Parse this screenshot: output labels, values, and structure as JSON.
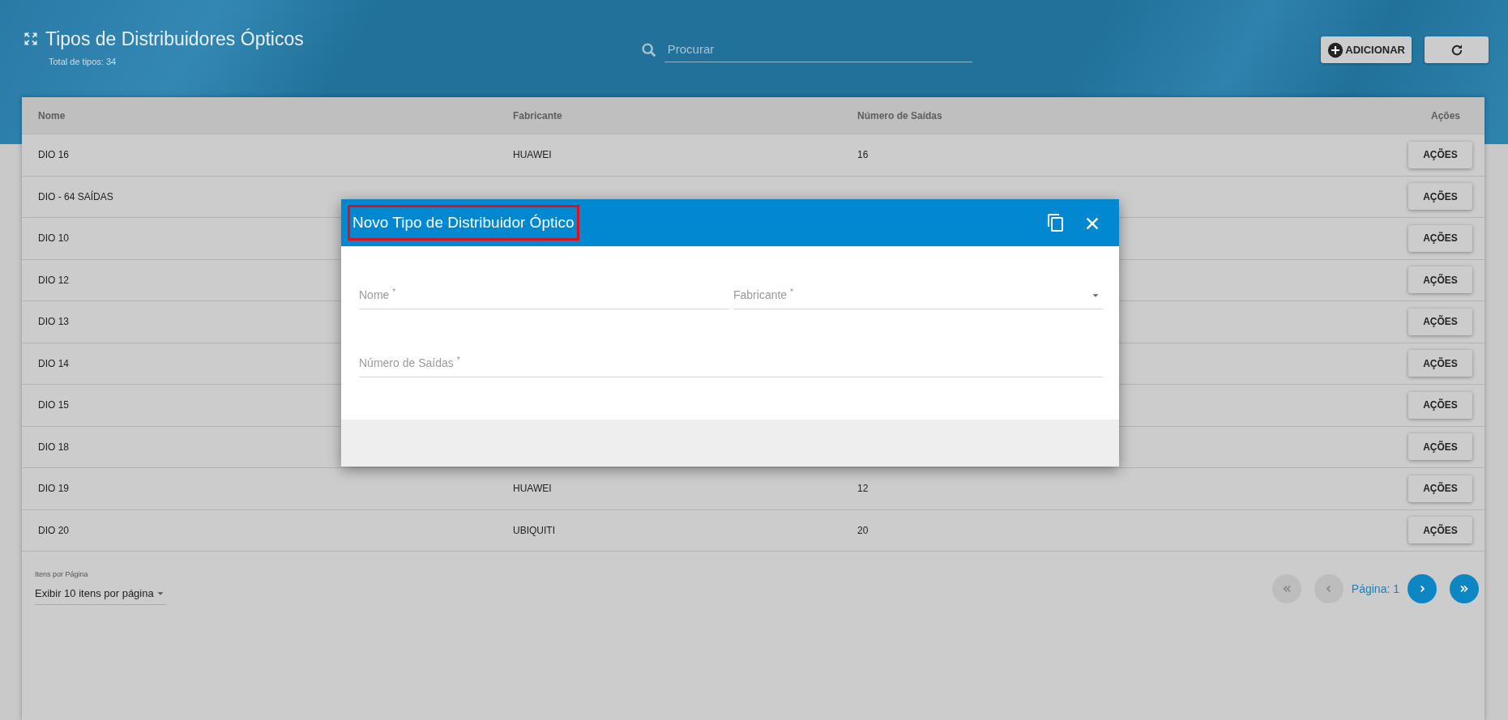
{
  "header": {
    "title": "Tipos de Distribuidores Ópticos",
    "subtitle": "Total de tipos: 34",
    "search": {
      "placeholder": "Procurar"
    },
    "add_button": "ADICIONAR"
  },
  "table": {
    "columns": [
      "Nome",
      "Fabricante",
      "Número de Saídas",
      "Ações"
    ],
    "rows": [
      {
        "nome": "DIO 16",
        "fabricante": "HUAWEI",
        "saidas": "16",
        "action": "AÇÕES"
      },
      {
        "nome": "DIO - 64 SAÍDAS",
        "action": "AÇÕES"
      },
      {
        "nome": "DIO 10",
        "action": "AÇÕES"
      },
      {
        "nome": "DIO 12",
        "action": "AÇÕES"
      },
      {
        "nome": "DIO 13",
        "action": "AÇÕES"
      },
      {
        "nome": "DIO 14",
        "action": "AÇÕES"
      },
      {
        "nome": "DIO 15",
        "action": "AÇÕES"
      },
      {
        "nome": "DIO 18",
        "action": "AÇÕES"
      },
      {
        "nome": "DIO 19",
        "fabricante": "HUAWEI",
        "saidas": "12",
        "action": "AÇÕES"
      },
      {
        "nome": "DIO 20",
        "fabricante": "UBIQUITI",
        "saidas": "20",
        "action": "AÇÕES"
      }
    ]
  },
  "pagination": {
    "per_page_label": "Itens por Página",
    "per_page_value": "Exibir 10 itens por página",
    "page_label": "Página: 1",
    "buttons": [
      {
        "kind": "first",
        "disabled": true
      },
      {
        "kind": "prev",
        "disabled": true
      },
      {
        "kind": "next",
        "disabled": false
      },
      {
        "kind": "last",
        "disabled": false
      }
    ]
  },
  "modal": {
    "title": "Novo Tipo de Distribuidor Óptico",
    "title_highlighted": true,
    "fields": [
      {
        "kind": "text",
        "label": "Nome $^{*}$"
      },
      {
        "kind": "select",
        "label": "Fabricante $^{*}$"
      },
      {
        "kind": "text",
        "label": "Número de Saídas $^{*}$"
      }
    ]
  }
}
